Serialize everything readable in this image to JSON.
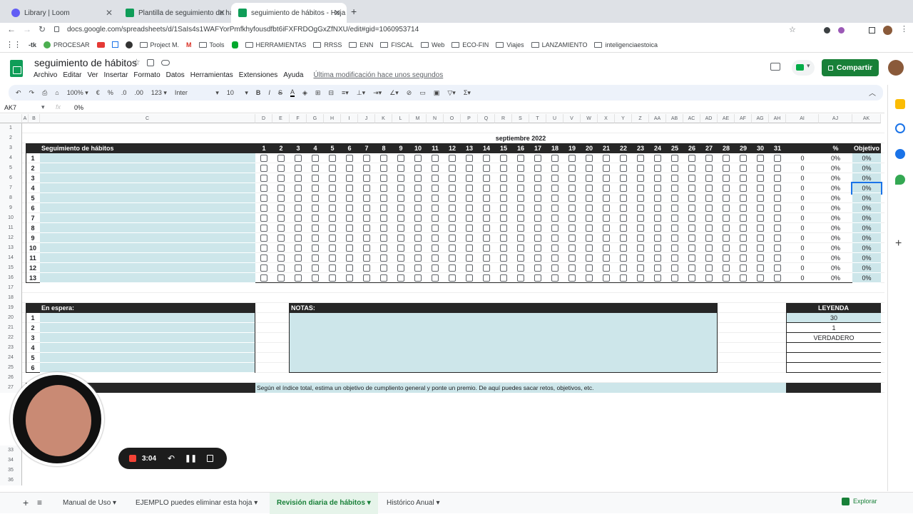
{
  "browser": {
    "tabs": [
      {
        "title": "Library | Loom",
        "active": false
      },
      {
        "title": "Plantilla de seguimiento de há",
        "active": false
      },
      {
        "title": "seguimiento de hábitos - Hoja",
        "active": true
      }
    ],
    "url": "docs.google.com/spreadsheets/d/1SaIs4s1WAFYorPmfkhyfousdfbt6iFXFRDOgGxZfNXU/edit#gid=1060953714",
    "bookmarks": [
      "PROCESAR",
      "Project M.",
      "Tools",
      "HERRAMIENTAS",
      "RRSS",
      "ENN",
      "FISCAL",
      "Web",
      "ECO-FIN",
      "Viajes",
      "LANZAMIENTO",
      "inteligenciaestoica"
    ]
  },
  "app": {
    "doc_title": "seguimiento de hábitos",
    "menu": [
      "Archivo",
      "Editar",
      "Ver",
      "Insertar",
      "Formato",
      "Datos",
      "Herramientas",
      "Extensiones",
      "Ayuda"
    ],
    "last_modified": "Última modificación hace unos segundos",
    "share_label": "Compartir"
  },
  "toolbar": {
    "zoom": "100%",
    "currency": "€",
    "percent": "%",
    "dec_less": ".0",
    "dec_more": ".00",
    "format": "123",
    "font": "Inter",
    "size": "10",
    "bold": "B",
    "italic": "I",
    "strike": "S",
    "text_color": "A",
    "sigma": "Σ"
  },
  "formula_bar": {
    "cell_ref": "AK7",
    "fx": "fx",
    "value": "0%"
  },
  "grid": {
    "columns": [
      "A",
      "B",
      "C",
      "D",
      "E",
      "F",
      "G",
      "H",
      "I",
      "J",
      "K",
      "L",
      "M",
      "N",
      "O",
      "P",
      "Q",
      "R",
      "S",
      "T",
      "U",
      "V",
      "W",
      "X",
      "Y",
      "Z",
      "AA",
      "AB",
      "AC",
      "AD",
      "AE",
      "AF",
      "AG",
      "AH",
      "AI",
      "AJ",
      "AK"
    ],
    "row_numbers": [
      "1",
      "2",
      "3",
      "4",
      "5",
      "6",
      "7",
      "8",
      "9",
      "10",
      "11",
      "12",
      "13",
      "14",
      "15",
      "16",
      "17",
      "18",
      "19",
      "20",
      "21",
      "22",
      "23",
      "24",
      "25",
      "26",
      "27",
      "33",
      "34",
      "35",
      "36"
    ],
    "month": "septiembre 2022",
    "tracker_title": "Seguimiento de hábitos",
    "days": [
      "1",
      "2",
      "3",
      "4",
      "5",
      "6",
      "7",
      "8",
      "9",
      "10",
      "11",
      "12",
      "13",
      "14",
      "15",
      "16",
      "17",
      "18",
      "19",
      "20",
      "21",
      "22",
      "23",
      "24",
      "25",
      "26",
      "27",
      "28",
      "29",
      "30",
      "31"
    ],
    "percent_header": "%",
    "objective_header": "Objetivo",
    "habit_rows": [
      {
        "n": "1",
        "count": "0",
        "pct": "0%",
        "obj": "0%"
      },
      {
        "n": "2",
        "count": "0",
        "pct": "0%",
        "obj": "0%"
      },
      {
        "n": "3",
        "count": "0",
        "pct": "0%",
        "obj": "0%"
      },
      {
        "n": "4",
        "count": "0",
        "pct": "0%",
        "obj": "0%"
      },
      {
        "n": "5",
        "count": "0",
        "pct": "0%",
        "obj": "0%"
      },
      {
        "n": "6",
        "count": "0",
        "pct": "0%",
        "obj": "0%"
      },
      {
        "n": "7",
        "count": "0",
        "pct": "0%",
        "obj": "0%"
      },
      {
        "n": "8",
        "count": "0",
        "pct": "0%",
        "obj": "0%"
      },
      {
        "n": "9",
        "count": "0",
        "pct": "0%",
        "obj": "0%"
      },
      {
        "n": "10",
        "count": "0",
        "pct": "0%",
        "obj": "0%"
      },
      {
        "n": "11",
        "count": "0",
        "pct": "0%",
        "obj": "0%"
      },
      {
        "n": "12",
        "count": "0",
        "pct": "0%",
        "obj": "0%"
      },
      {
        "n": "13",
        "count": "0",
        "pct": "0%",
        "obj": "0%"
      }
    ],
    "en_espera_title": "En espera:",
    "en_espera_rows": [
      "1",
      "2",
      "3",
      "4",
      "5",
      "6"
    ],
    "notas_title": "NOTAS:",
    "leyenda_title": "LEYENDA",
    "leyenda_values": [
      "30",
      "1",
      "VERDADERO"
    ],
    "footer_text": "Según el índice total, estima un objetivo de cumpliento general y ponte un premio. De aquí puedes sacar retos, objetivos, etc."
  },
  "sheets": [
    {
      "name": "Manual de Uso",
      "active": false
    },
    {
      "name": "EJEMPLO puedes eliminar esta hoja",
      "active": false
    },
    {
      "name": "Revisión diaria de hábitos",
      "active": true
    },
    {
      "name": "Histórico Anual",
      "active": false
    }
  ],
  "explorar": "Explorar",
  "loom": {
    "time": "3:04"
  },
  "colors": {
    "header_black": "#262626",
    "teal": "#cde6ea",
    "share_green": "#188038",
    "sheet_active": "#188038"
  }
}
